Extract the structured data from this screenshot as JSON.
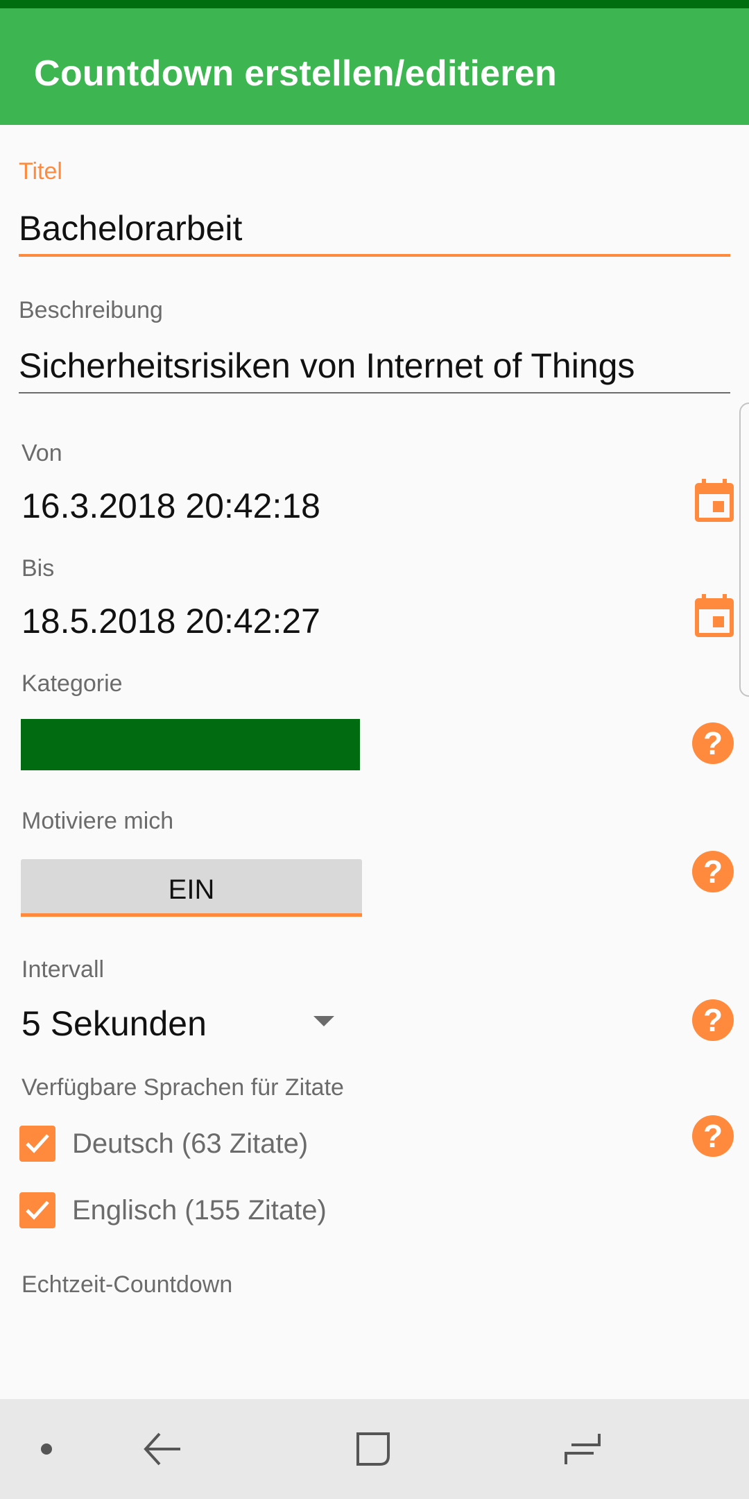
{
  "app_bar": {
    "title": "Countdown erstellen/editieren"
  },
  "form": {
    "title": {
      "label": "Titel",
      "value": "Bachelorarbeit"
    },
    "description": {
      "label": "Beschreibung",
      "value": "Sicherheitsrisiken von Internet of Things"
    },
    "from": {
      "label": "Von",
      "value": "16.3.2018 20:42:18"
    },
    "to": {
      "label": "Bis",
      "value": "18.5.2018 20:42:27"
    },
    "category": {
      "label": "Kategorie",
      "color": "#006b10"
    },
    "motivate": {
      "label": "Motiviere mich",
      "toggle_label": "EIN"
    },
    "interval": {
      "label": "Intervall",
      "value": "5 Sekunden"
    },
    "languages": {
      "label": "Verfügbare Sprachen für Zitate",
      "options": [
        {
          "label": "Deutsch (63 Zitate)",
          "checked": true
        },
        {
          "label": "Englisch (155 Zitate)",
          "checked": true
        }
      ]
    },
    "realtime": {
      "label": "Echtzeit-Countdown"
    }
  },
  "icons": {
    "calendar": "calendar-icon",
    "help": "help-icon",
    "help_glyph": "?",
    "check": "check-icon"
  },
  "colors": {
    "app_bar": "#3db651",
    "status_bar": "#006e0e",
    "accent": "#ff8a3d",
    "category": "#006b10"
  }
}
